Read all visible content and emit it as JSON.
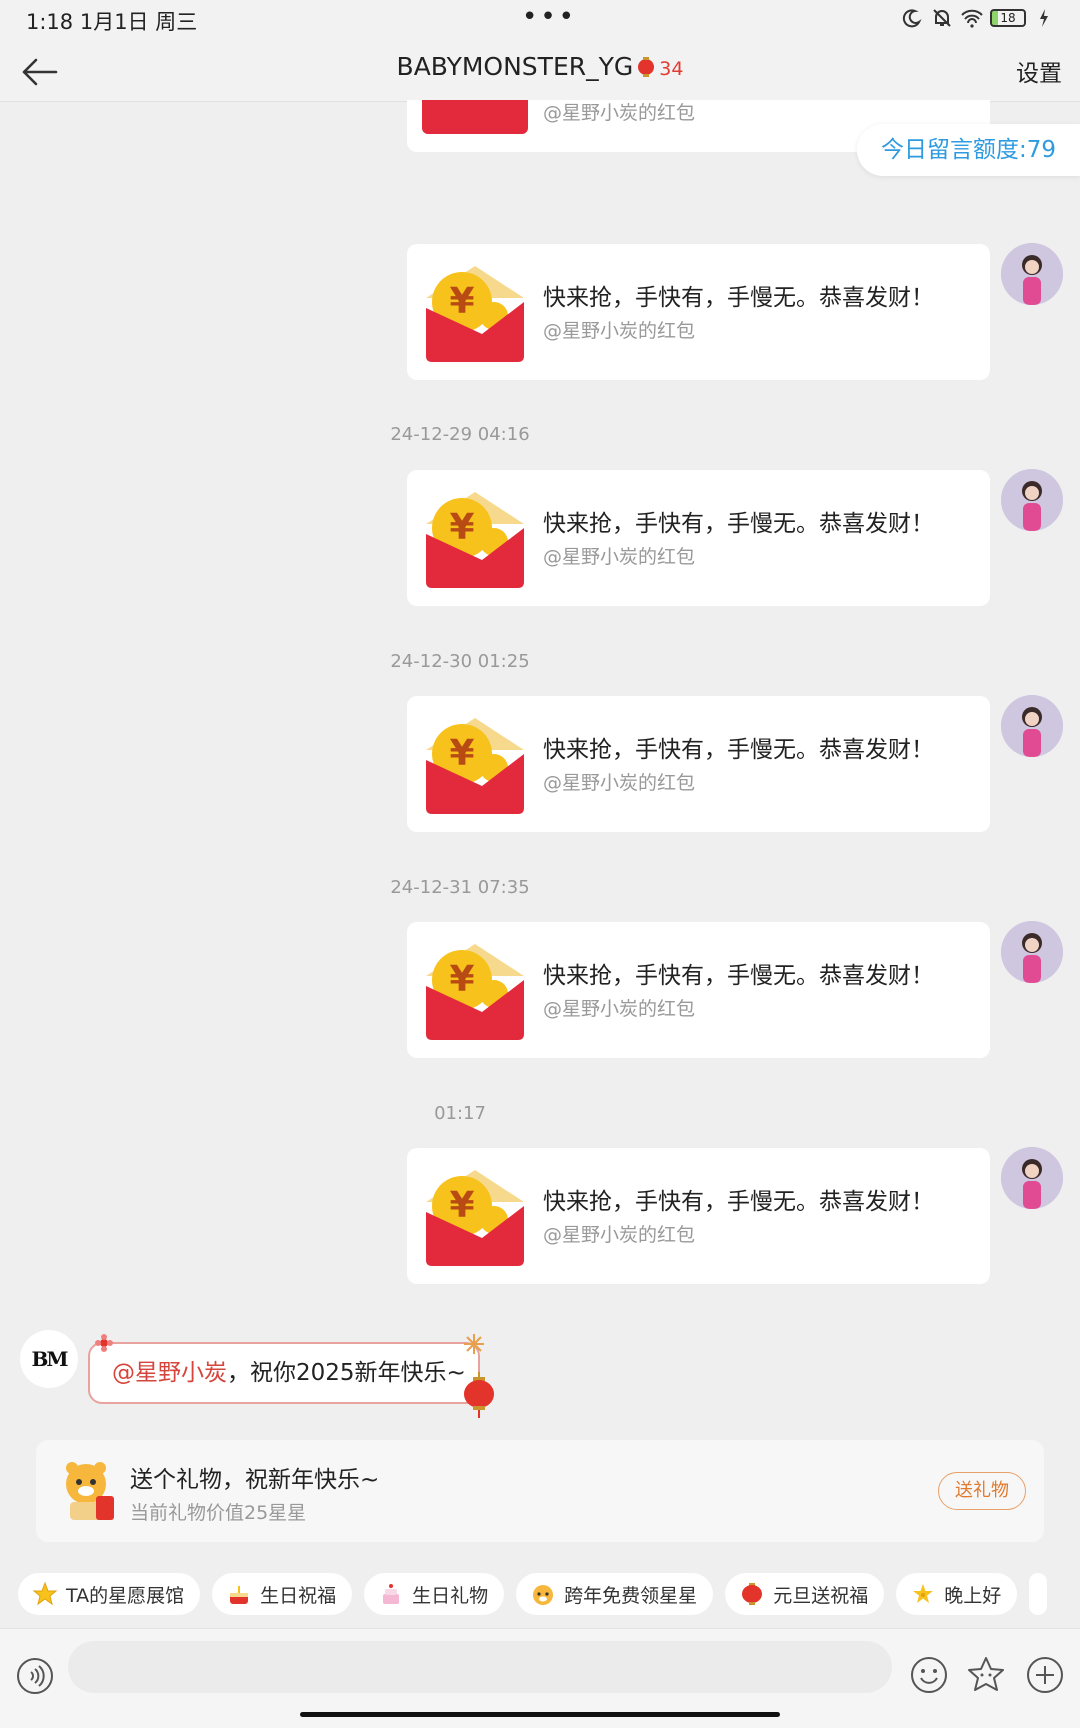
{
  "status_bar": {
    "time_date": "1:18  1月1日 周三",
    "dots": "•••",
    "battery": "18"
  },
  "header": {
    "title": "BABYMONSTER_YG",
    "badge_count": "34",
    "settings": "设置"
  },
  "quota": {
    "text": "今日留言额度:79"
  },
  "partial_card": {
    "sub": "@星野小炭的红包"
  },
  "messages": [
    {
      "timestamp": "",
      "text": "快来抢，手快有，手慢无。恭喜发财！",
      "sub": "@星野小炭的红包"
    },
    {
      "timestamp": "24-12-29 04:16",
      "text": "快来抢，手快有，手慢无。恭喜发财！",
      "sub": "@星野小炭的红包"
    },
    {
      "timestamp": "24-12-30 01:25",
      "text": "快来抢，手快有，手慢无。恭喜发财！",
      "sub": "@星野小炭的红包"
    },
    {
      "timestamp": "24-12-31 07:35",
      "text": "快来抢，手快有，手慢无。恭喜发财！",
      "sub": "@星野小炭的红包"
    },
    {
      "timestamp": "01:17",
      "text": "快来抢，手快有，手慢无。恭喜发财！",
      "sub": "@星野小炭的红包"
    }
  ],
  "mention": {
    "avatar_text": "BM",
    "at": "@星野小炭",
    "rest": "，祝你2025新年快乐~"
  },
  "gift": {
    "title": "送个礼物，祝新年快乐~",
    "sub": "当前礼物价值25星星",
    "button": "送礼物"
  },
  "chips": [
    {
      "label": "TA的星愿展馆",
      "icon": "star-icon"
    },
    {
      "label": "生日祝福",
      "icon": "cake-icon"
    },
    {
      "label": "生日礼物",
      "icon": "cake-gift-icon"
    },
    {
      "label": "跨年免费领星星",
      "icon": "tiger-icon"
    },
    {
      "label": "元旦送祝福",
      "icon": "lantern-icon"
    },
    {
      "label": "晚上好",
      "icon": "moon-star-icon"
    }
  ],
  "colors": {
    "accent_blue": "#2e9be0",
    "red": "#e32a3c",
    "gold": "#f7c21b",
    "orange": "#e07a2e"
  }
}
